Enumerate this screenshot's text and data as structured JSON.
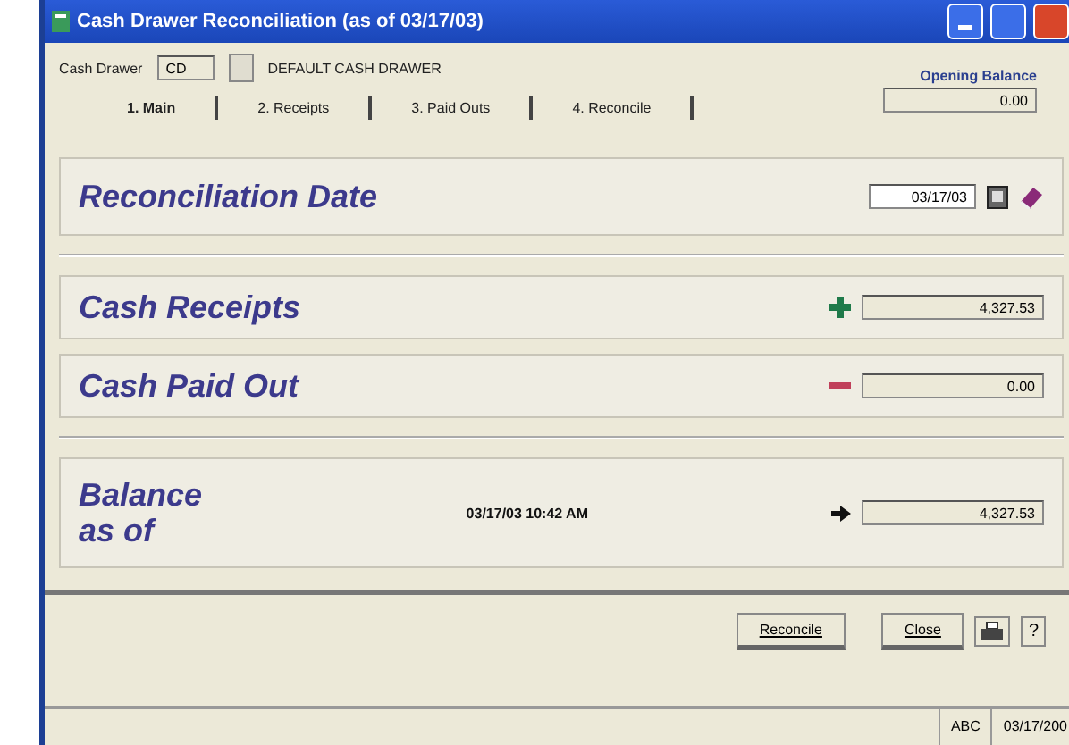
{
  "window": {
    "title": "Cash Drawer Reconciliation  (as of 03/17/03)"
  },
  "drawer": {
    "label": "Cash Drawer",
    "code": "CD",
    "name": "DEFAULT CASH DRAWER"
  },
  "opening_balance": {
    "label": "Opening Balance",
    "value": "0.00"
  },
  "tabs": [
    {
      "label": "1. Main",
      "selected": true
    },
    {
      "label": "2. Receipts",
      "selected": false
    },
    {
      "label": "3. Paid Outs",
      "selected": false
    },
    {
      "label": "4. Reconcile",
      "selected": false
    }
  ],
  "reconciliation_date": {
    "label": "Reconciliation Date",
    "value": "03/17/03"
  },
  "amounts": [
    {
      "label": "Cash Receipts",
      "kind": "plus",
      "value": "4,327.53"
    },
    {
      "label": "Cash Paid Out",
      "kind": "minus",
      "value": "0.00"
    }
  ],
  "balance": {
    "label_lines": [
      "Balance",
      "as of"
    ],
    "timestamp": "03/17/03 10:42 AM",
    "value": "4,327.53"
  },
  "buttons": [
    {
      "label": "Reconcile"
    },
    {
      "label": "Close"
    }
  ],
  "help": "?",
  "status_bar": [
    "ABC",
    "03/17/200"
  ]
}
